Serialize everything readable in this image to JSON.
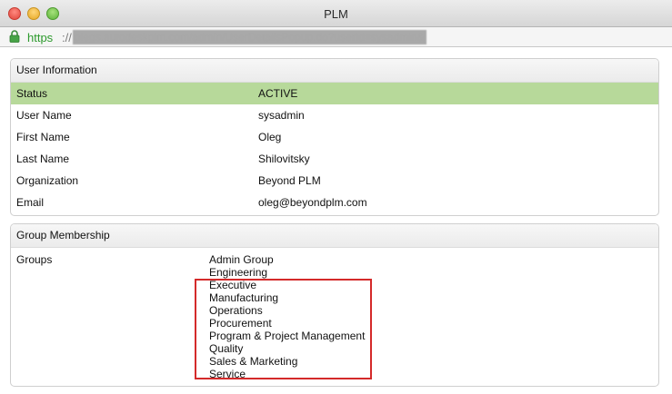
{
  "window": {
    "title": "PLM"
  },
  "url": {
    "scheme": "https",
    "separator": "://",
    "path": "olegs.autodeskplm.com/admin/UserDetailsPopup.do?userId=sysadmin&"
  },
  "user_info": {
    "header": "User Information",
    "rows": [
      {
        "label": "Status",
        "value": "ACTIVE"
      },
      {
        "label": "User Name",
        "value": "sysadmin"
      },
      {
        "label": "First Name",
        "value": "Oleg"
      },
      {
        "label": "Last Name",
        "value": "Shilovitsky"
      },
      {
        "label": "Organization",
        "value": "Beyond PLM"
      },
      {
        "label": "Email",
        "value": "oleg@beyondplm.com"
      }
    ]
  },
  "group_membership": {
    "header": "Group Membership",
    "label": "Groups",
    "groups": [
      "Admin Group",
      "Engineering",
      "Executive",
      "Manufacturing",
      "Operations",
      "Procurement",
      "Program & Project Management",
      "Quality",
      "Sales & Marketing",
      "Service"
    ]
  },
  "colors": {
    "status_row": "#b7d99a",
    "highlight_box": "#d42a2a",
    "https": "#2d9a2d"
  },
  "icons": {
    "lock": "lock-icon"
  }
}
